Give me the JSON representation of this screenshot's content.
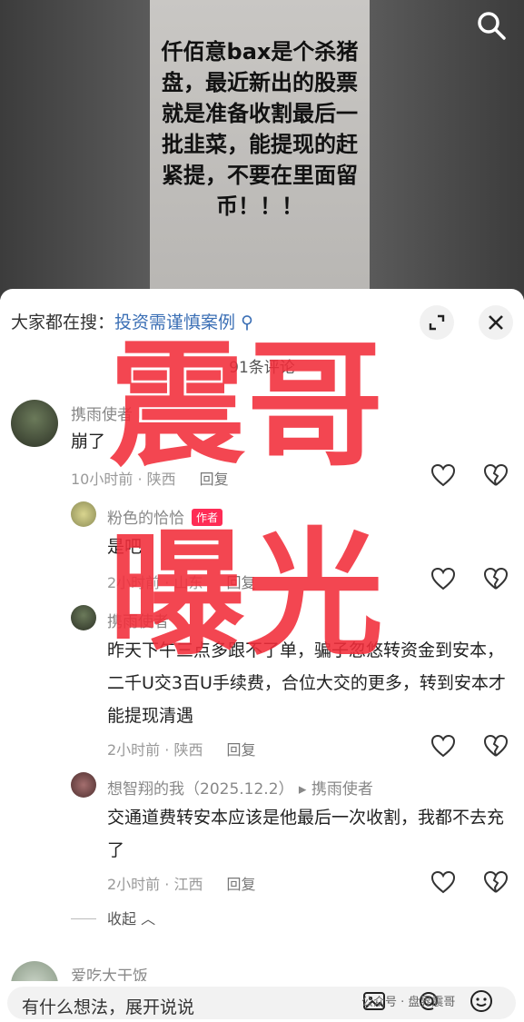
{
  "video": {
    "overlay_text": "仟佰意bax是个杀猪盘，最近新出的股票就是准备收割最后一批韭菜，能提现的赶紧提，不要在里面留币！！！"
  },
  "sheet": {
    "search_prefix": "大家都在搜：",
    "search_term": "投资需谨慎案例",
    "comment_count": "91条评论"
  },
  "comments": [
    {
      "user": "携雨使者",
      "text": "崩了",
      "time_loc": "10小时前 · 陕西",
      "reply": "回复"
    },
    {
      "user": "粉色的恰恰",
      "badge": "作者",
      "text": "是吧",
      "time_loc": "2小时前 · 山东",
      "reply": "回复"
    },
    {
      "user": "携雨使者",
      "text": "昨天下午三点多跟不了单，骗子忽悠转资金到安本，二千U交3百U手续费，合位大交的更多，转到安本才能提现清遇",
      "time_loc": "2小时前 · 陕西",
      "reply": "回复"
    },
    {
      "user": "想智翔的我（2025.12.2）",
      "reply_to": "携雨使者",
      "text": "交通道费转安本应该是他最后一次收割，我都不去充了",
      "time_loc": "2小时前 · 江西",
      "reply": "回复"
    },
    {
      "user": "爱吃大干饭"
    }
  ],
  "collapse_label": "收起",
  "input": {
    "placeholder": "有什么想法，展开说说"
  },
  "watermark": "公众号 · 盘界震哥",
  "overlay": {
    "line1": "震哥",
    "line2": "曝光"
  },
  "colors": {
    "accent": "#fe2c55",
    "overlay_red": "#f22d3a",
    "link": "#3b6fb5"
  },
  "icons": [
    "search-icon",
    "expand-icon",
    "close-icon",
    "heart-icon",
    "broken-heart-icon",
    "image-icon",
    "at-icon",
    "emoji-icon"
  ]
}
